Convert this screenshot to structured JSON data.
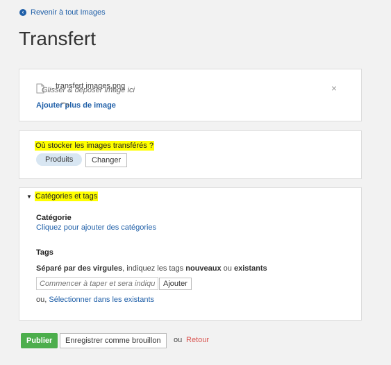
{
  "nav": {
    "back_label": "Revenir à tout Images"
  },
  "page": {
    "title": "Transfert"
  },
  "upload": {
    "file_name": "transfert images.png",
    "drop_hint": "Glisser & déposer image ici",
    "choose_label": "Ajouter plus de image",
    "overlap_text": "'\">",
    "close_symbol": "×"
  },
  "storage": {
    "question": "Où stocker les images transférés ?",
    "selected": "Produits",
    "change_label": "Changer"
  },
  "categories": {
    "toggle_label": "Catégories et tags",
    "category_label": "Catégorie",
    "category_link": "Cliquez pour ajouter des catégories",
    "tags_label": "Tags",
    "tags_help_1": "Séparé par des virgules",
    "tags_help_2": ", indiquez les tags ",
    "tags_help_3": "nouveaux",
    "tags_help_4": " ou ",
    "tags_help_5": "existants",
    "tags_placeholder": "Commencer à taper et sera indiqué",
    "add_label": "Ajouter",
    "or_prefix": "ou, ",
    "select_existing": "Sélectionner dans les existants"
  },
  "actions": {
    "publish": "Publier",
    "draft": "Enregistrer comme brouillon",
    "or": "ou",
    "back": "Retour"
  },
  "colors": {
    "accent": "#1f5fa8",
    "publish_green": "#4cae4c",
    "highlight": "#ffff00",
    "back_red": "#d9534f"
  }
}
